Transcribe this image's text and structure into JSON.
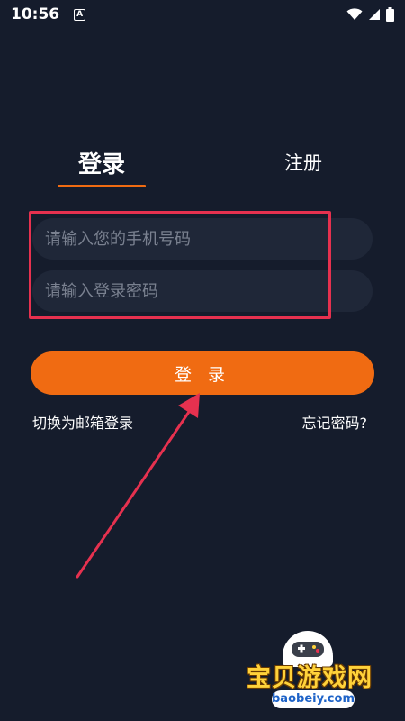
{
  "status_bar": {
    "time": "10:56",
    "notification_letter": "A",
    "icons": [
      "wifi-icon",
      "signal-icon",
      "battery-icon"
    ]
  },
  "tabs": [
    {
      "label": "登录",
      "active": true
    },
    {
      "label": "注册",
      "active": false
    }
  ],
  "form": {
    "phone_placeholder": "请输入您的手机号码",
    "phone_value": "",
    "password_placeholder": "请输入登录密码",
    "password_value": ""
  },
  "login_button_label": "登 录",
  "links": {
    "switch_email": "切换为邮箱登录",
    "forgot_password": "忘记密码?"
  },
  "watermark": {
    "title": "宝贝游戏网",
    "url": "baobeiy.com"
  },
  "colors": {
    "background": "#151c2c",
    "accent": "#f06b12",
    "input_bg": "#1f2738",
    "highlight": "#e6314f"
  }
}
